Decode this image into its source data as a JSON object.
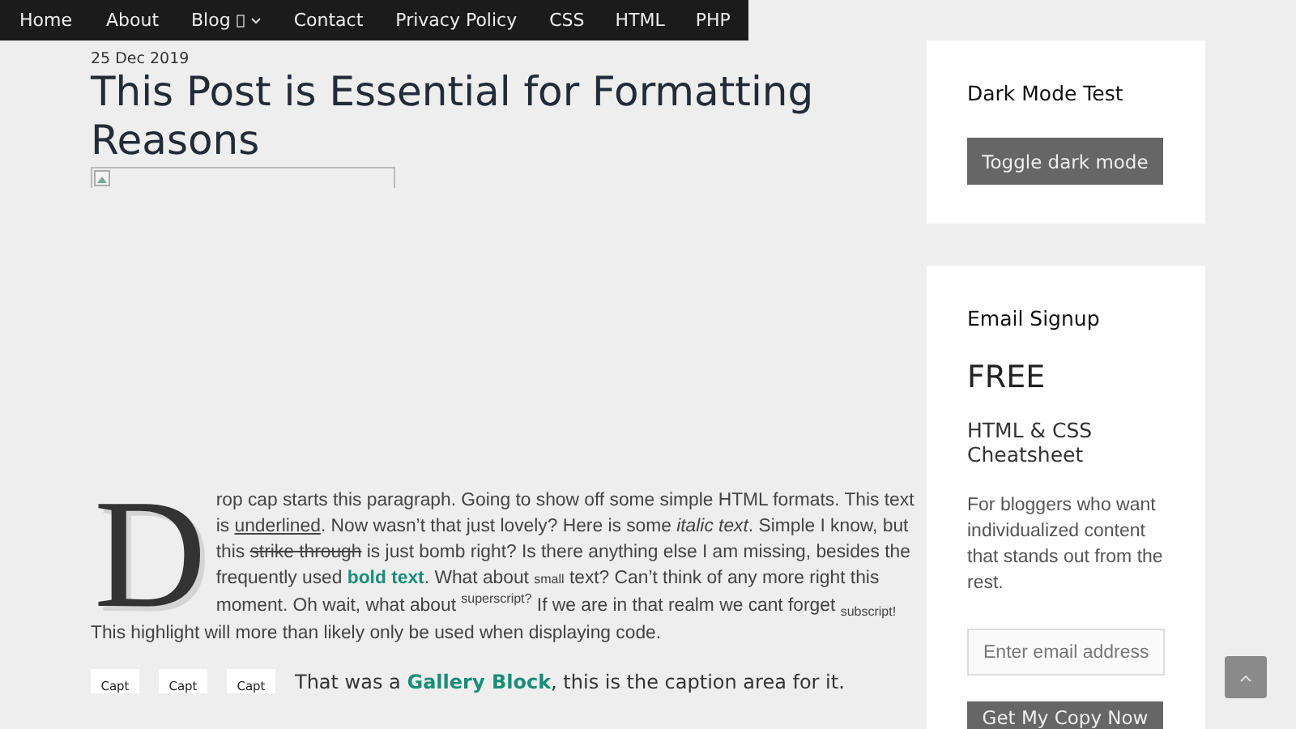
{
  "header": {
    "nav": [
      {
        "label": "Home",
        "kind": "plain"
      },
      {
        "label": "About",
        "kind": "plain"
      },
      {
        "label": "Blog",
        "kind": "dropdown"
      },
      {
        "label": "Contact",
        "kind": "plain"
      },
      {
        "label": "Privacy Policy",
        "kind": "plain"
      },
      {
        "label": "CSS",
        "kind": "plain"
      },
      {
        "label": "HTML",
        "kind": "plain"
      },
      {
        "label": "PHP",
        "kind": "plain"
      }
    ]
  },
  "post": {
    "date": "25 Dec 2019",
    "title": "This Post is Essential for Formatting Reasons",
    "image": {
      "kind": "broken"
    },
    "drop_cap": "D",
    "paragraph": [
      {
        "kind": "plain",
        "text": "rop cap starts this paragraph. Going to show off some simple HTML formats. This text is "
      },
      {
        "kind": "underline",
        "text": "underlined"
      },
      {
        "kind": "plain",
        "text": ". Now wasn’t that just lovely? Here is some "
      },
      {
        "kind": "italic",
        "text": "italic text"
      },
      {
        "kind": "plain",
        "text": ". Simple I know, but this "
      },
      {
        "kind": "strike",
        "text": "strike through"
      },
      {
        "kind": "plain",
        "text": " is just bomb right? Is there anything else I am missing, besides the frequently used "
      },
      {
        "kind": "bold",
        "text": "bold text"
      },
      {
        "kind": "plain",
        "text": ". What about "
      },
      {
        "kind": "small",
        "text": "small"
      },
      {
        "kind": "plain",
        "text": " text? Can’t think of any more right this moment. Oh wait, what about "
      },
      {
        "kind": "sup",
        "text": "superscript?"
      },
      {
        "kind": "plain",
        "text": " If we are in that realm we cant forget "
      },
      {
        "kind": "sub",
        "text": "subscript!"
      },
      {
        "kind": "plain",
        "text": " This highlight will more than likely only be used when displaying code."
      }
    ],
    "gallery": [
      "Capt",
      "Capt",
      "Capt"
    ],
    "gallery_caption": "That was a **Gallery Block**, this is the caption area for it."
  },
  "sidebar": {
    "dark_mode": {
      "title": "Dark Mode Test",
      "button": "Toggle dark mode"
    },
    "signup": {
      "title": "Email Signup",
      "headline": "FREE",
      "subtitle": "HTML & CSS Cheatsheet",
      "text": "For bloggers who want individualized content that stands out from the rest.",
      "placeholder": "Enter email address",
      "button": "Get My Copy Now"
    }
  }
}
